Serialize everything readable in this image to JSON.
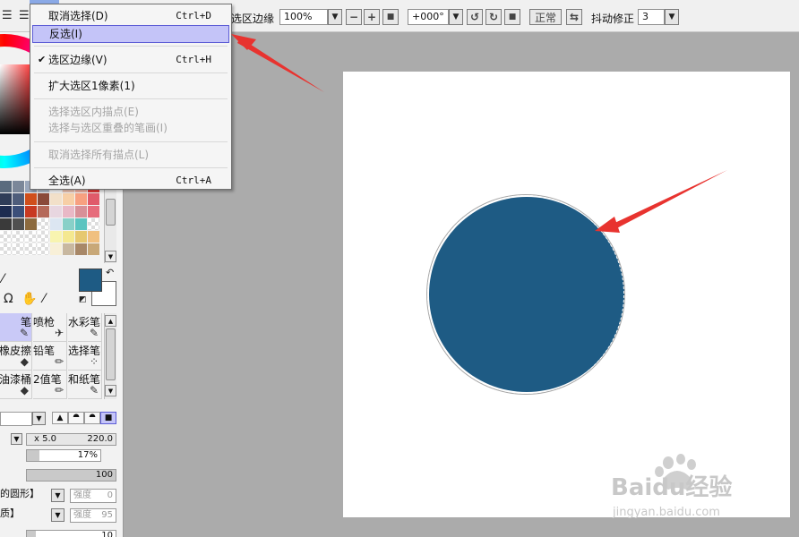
{
  "toolbar": {
    "selection_edge_label": "选区边缘",
    "zoom_value": "100%",
    "rotation_value": "+000°",
    "blend_mode_label": "正常",
    "stabilizer_label": "抖动修正",
    "stabilizer_value": "3"
  },
  "select_menu": {
    "items": [
      {
        "label": "取消选择(D)",
        "shortcut": "Ctrl+D",
        "state": "normal"
      },
      {
        "label": "反选(I)",
        "shortcut": "",
        "state": "highlighted"
      },
      {
        "label": "选区边缘(V)",
        "shortcut": "Ctrl+H",
        "state": "checked"
      },
      {
        "label": "扩大选区1像素(1)",
        "shortcut": "",
        "state": "normal"
      },
      {
        "label": "选择选区内描点(E)",
        "shortcut": "",
        "state": "disabled"
      },
      {
        "label": "选择与选区重叠的笔画(I)",
        "shortcut": "",
        "state": "disabled"
      },
      {
        "label": "取消选择所有描点(L)",
        "shortcut": "",
        "state": "disabled"
      },
      {
        "label": "全选(A)",
        "shortcut": "Ctrl+A",
        "state": "normal"
      }
    ]
  },
  "colors": {
    "foreground": "#1e5b84",
    "circle": "#1e5b84",
    "menu_highlight": "#c4c4f8",
    "annotation_arrow": "#e8332f"
  },
  "swatches": [
    "#5a6b7e",
    "#7b8799",
    "#9aa7bb",
    "#b6c0cf",
    "#ffffff",
    "#f4c9b8",
    "#f8b7a8",
    "#e93a3a",
    "#2f3d58",
    "#4e5d7b",
    "#d04f1c",
    "#8a4a3a",
    "#f2e0c9",
    "#f7cfa6",
    "#f7a080",
    "#e05a6a",
    "#1d2c50",
    "#3b4f7a",
    "#c83a22",
    "#b56a5a",
    "#e8d6e0",
    "#e9b8c6",
    "#d89098",
    "#e66b7b",
    "#3a3a3a",
    "#505050",
    "#8c6a3e",
    "empty",
    "#dce6f2",
    "#88d0c8",
    "#5cc4c0",
    "empty",
    "empty",
    "empty",
    "empty",
    "empty",
    "#f8f4b0",
    "#f4e890",
    "#e6c870",
    "#f0c080",
    "empty",
    "empty",
    "empty",
    "empty",
    "#f8f0d8",
    "#c8b8a0",
    "#a88868",
    "#c8a878"
  ],
  "brushes": [
    {
      "label": "笔",
      "icon": "pen-icon",
      "glyph": "✎",
      "selected": true
    },
    {
      "label": "喷枪",
      "icon": "airbrush-icon",
      "glyph": "✈",
      "selected": false
    },
    {
      "label": "水彩笔",
      "icon": "watercolor-icon",
      "glyph": "✎",
      "selected": false
    },
    {
      "label": "橡皮擦",
      "icon": "eraser-icon",
      "glyph": "◆",
      "selected": false
    },
    {
      "label": "铅笔",
      "icon": "pencil-icon",
      "glyph": "✏",
      "selected": false
    },
    {
      "label": "选择笔",
      "icon": "selection-pen-icon",
      "glyph": "⁘",
      "selected": false
    },
    {
      "label": "油漆桶",
      "icon": "bucket-icon",
      "glyph": "◆",
      "selected": false
    },
    {
      "label": "2值笔",
      "icon": "binary-pen-icon",
      "glyph": "✏",
      "selected": false
    },
    {
      "label": "和纸笔",
      "icon": "washi-pen-icon",
      "glyph": "✎",
      "selected": false
    }
  ],
  "brush_settings": {
    "size_multiplier": "x 5.0",
    "size_value": "220.0",
    "min_size_value": "17%",
    "min_size_fraction": 0.17,
    "density_value": "100",
    "density_fraction": 1.0,
    "shape_label": "的圆形】",
    "shape_strength_label": "强度",
    "shape_strength_value": "0",
    "texture_label": "质】",
    "texture_strength_label": "强度",
    "texture_strength_value": "95",
    "bottom_value": "10"
  },
  "watermark": {
    "brand": "Baidu经验",
    "url": "jingyan.baidu.com"
  }
}
